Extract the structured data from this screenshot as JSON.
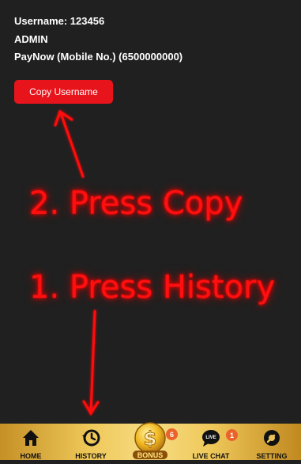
{
  "account": {
    "username_line": "Username: 123456",
    "name": "ADMIN",
    "payment_line": "PayNow (Mobile No.) (6500000000)"
  },
  "copy_button_label": "Copy Username",
  "annotations": {
    "step2": "2. Press Copy",
    "step1": "1. Press History"
  },
  "nav": {
    "home_label": "HOME",
    "history_label": "HISTORY",
    "bonus_label": "BONUS",
    "bonus_badge": "6",
    "live_chat_label": "LIVE CHAT",
    "live_chat_icon_text": "LIVE",
    "live_chat_badge": "1",
    "setting_label": "SETTING"
  },
  "colors": {
    "background": "#202020",
    "button": "#e8141c",
    "annotation": "#ff1010",
    "navbar_gold": "#efc85a"
  }
}
